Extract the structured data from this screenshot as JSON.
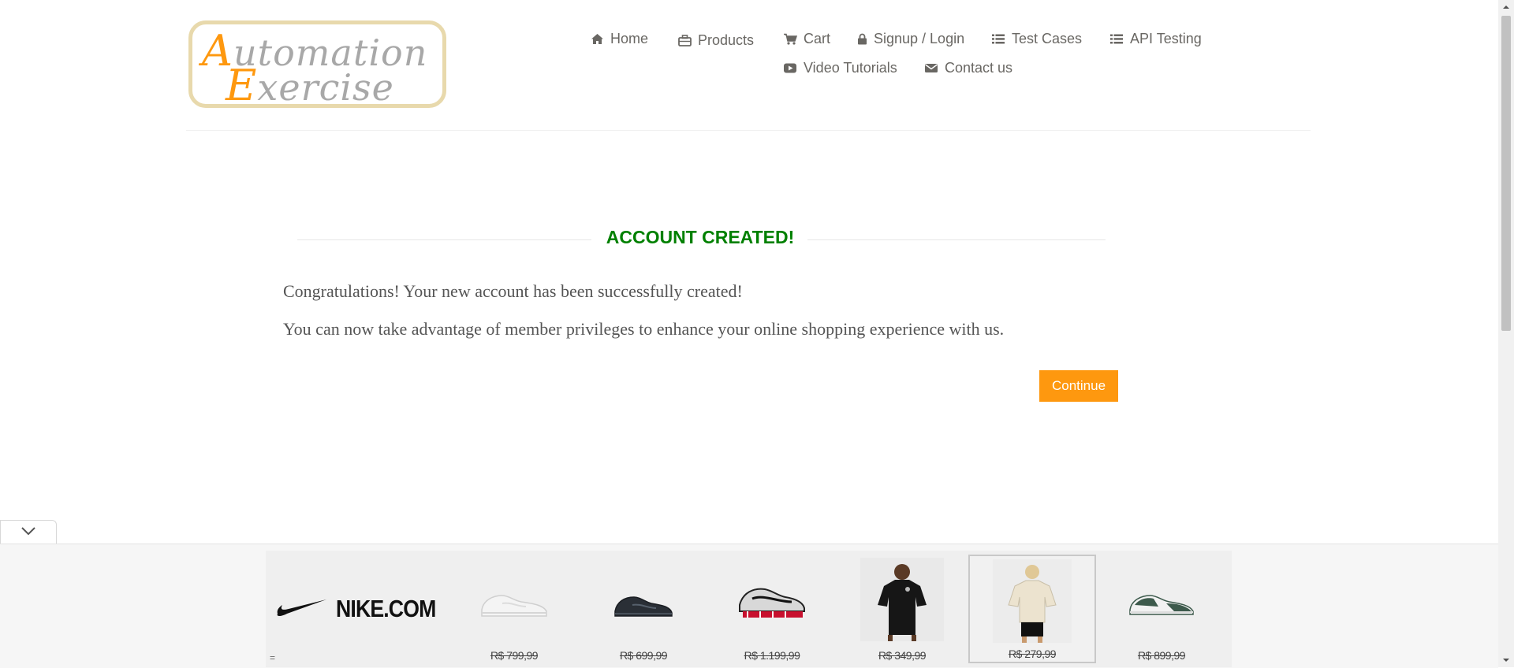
{
  "header": {
    "logo_line1_cap": "A",
    "logo_line1_rest": "utomation",
    "logo_line2_cap": "E",
    "logo_line2_rest": "xercise",
    "nav": [
      {
        "label": "Home",
        "icon": "home-icon"
      },
      {
        "label": "Products",
        "icon": "briefcase-icon"
      },
      {
        "label": "Cart",
        "icon": "cart-icon"
      },
      {
        "label": "Signup / Login",
        "icon": "lock-icon"
      },
      {
        "label": "Test Cases",
        "icon": "list-icon"
      },
      {
        "label": "API Testing",
        "icon": "list-icon"
      },
      {
        "label": "Video Tutorials",
        "icon": "youtube-icon"
      },
      {
        "label": "Contact us",
        "icon": "envelope-icon"
      }
    ]
  },
  "main": {
    "title": "ACCOUNT CREATED!",
    "message1": "Congratulations! Your new account has been successfully created!",
    "message2": "You can now take advantage of member privileges to enhance your online shopping experience with us.",
    "continue_label": "Continue"
  },
  "ad": {
    "brand": "NIKE.COM",
    "products": [
      {
        "name": "white-sneaker",
        "price": "R$ 799,99"
      },
      {
        "name": "black-sneaker",
        "price": "R$ 699,99"
      },
      {
        "name": "silver-red-shox-sneaker",
        "price": "R$ 1.199,99"
      },
      {
        "name": "black-jersey",
        "price": "R$ 349,99"
      },
      {
        "name": "cream-jersey",
        "price": "R$ 279,99"
      },
      {
        "name": "green-dunk-sneaker",
        "price": "R$ 899,99"
      }
    ],
    "menu_glyph": "="
  },
  "colors": {
    "accent": "#fe980f",
    "title_green": "#008000",
    "nav_text": "#696763"
  }
}
